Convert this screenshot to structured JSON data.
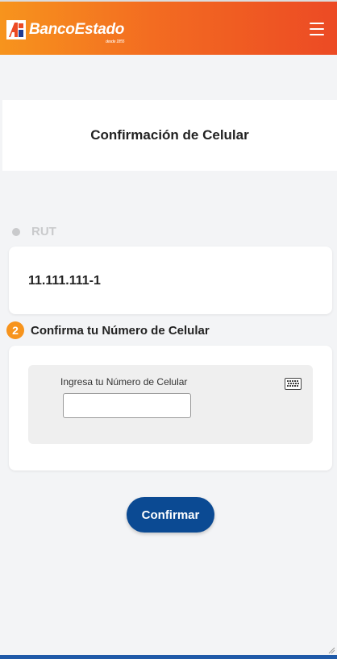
{
  "header": {
    "brand_name": "BancoEstado",
    "brand_tagline": "desde 1855",
    "brand_colors": {
      "orange": "#f7941d",
      "red": "#ec4a24"
    },
    "menu_icon": "hamburger-menu-icon"
  },
  "page": {
    "title": "Confirmación de Celular"
  },
  "step1": {
    "label": "RUT",
    "value": "11.111.111-1"
  },
  "step2": {
    "number": "2",
    "label": "Confirma tu Número de Celular",
    "field_label": "Ingresa tu Número de Celular",
    "input_value": "",
    "keyboard_icon": "keyboard-icon"
  },
  "actions": {
    "confirm_label": "Confirmar",
    "confirm_color": "#0b4a93"
  }
}
